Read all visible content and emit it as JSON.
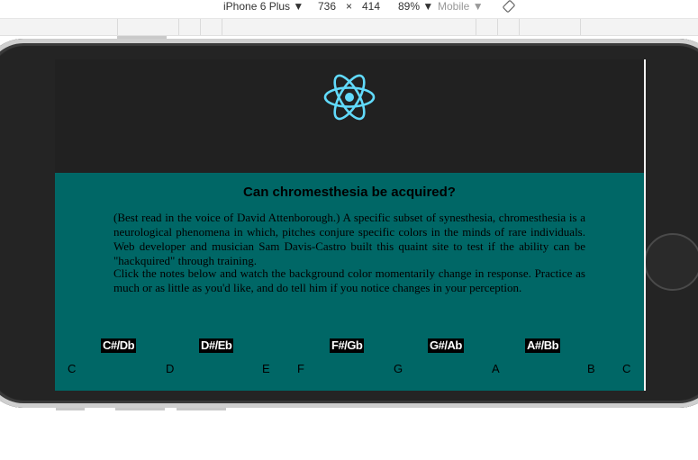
{
  "devtools": {
    "device": "iPhone 6 Plus",
    "width": "736",
    "times": "×",
    "height": "414",
    "zoom": "89%",
    "mode": "Mobile",
    "rotate_icon": "rotate-icon"
  },
  "page": {
    "logo_icon": "react-atom-icon",
    "title": "Can chromesthesia be acquired?",
    "paragraph1": "(Best read in the voice of David Attenborough.) A specific subset of synesthesia, chromesthesia is a neurological phenomena in which, pitches conjure specific colors in the minds of rare individuals. Web developer and musician Sam Davis-Castro built this quaint site to test if the ability can be \"hackquired\" through training.",
    "paragraph2": "Click the notes below and watch the background color momentarily change in response. Practice as much or as little as you'd like, and do tell him if you notice changes in your perception.",
    "sharp_keys": [
      "C#/Db",
      "D#/Eb",
      "F#/Gb",
      "G#/Ab",
      "A#/Bb"
    ],
    "natural_keys": [
      "C",
      "D",
      "E",
      "F",
      "G",
      "A",
      "B",
      "C"
    ],
    "colors": {
      "header_bg": "#212121",
      "content_bg": "#006766",
      "logo": "#61dafb"
    }
  }
}
